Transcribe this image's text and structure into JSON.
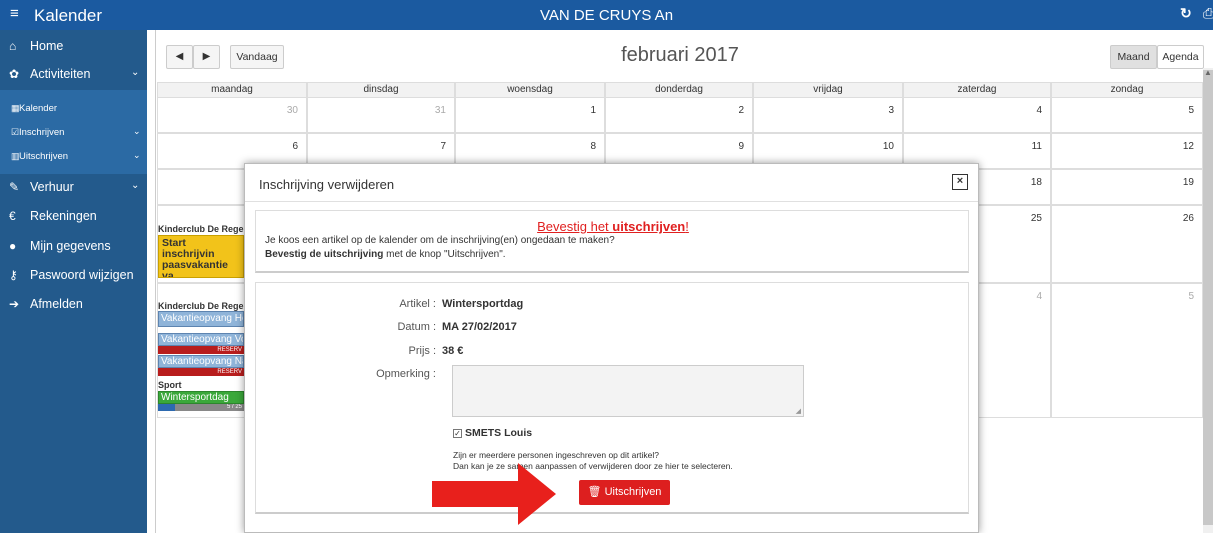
{
  "topbar": {
    "menu_icon": "hamburger-icon",
    "title": "Kalender",
    "user": "VAN DE CRUYS An",
    "refresh_icon": "refresh-icon",
    "print_icon": "print-icon"
  },
  "sidebar": {
    "items": [
      {
        "icon": "home-icon",
        "label": "Home"
      },
      {
        "icon": "activities-icon",
        "label": "Activiteiten"
      },
      {
        "icon": "rent-icon",
        "label": "Verhuur"
      },
      {
        "icon": "euro-icon",
        "label": "Rekeningen"
      },
      {
        "icon": "user-icon",
        "label": "Mijn gegevens"
      },
      {
        "icon": "key-icon",
        "label": "Paswoord wijzigen"
      },
      {
        "icon": "logout-icon",
        "label": "Afmelden"
      }
    ],
    "subitems": [
      {
        "icon": "calendar-icon",
        "label": "Kalender"
      },
      {
        "icon": "edit-icon",
        "label": "Inschrijven"
      },
      {
        "icon": "trash-icon",
        "label": "Uitschrijven"
      }
    ]
  },
  "calendar": {
    "prev": "◀",
    "next": "▶",
    "today": "Vandaag",
    "month": "februari 2017",
    "view_month": "Maand",
    "view_agenda": "Agenda",
    "weekdays": [
      "maandag",
      "dinsdag",
      "woensdag",
      "donderdag",
      "vrijdag",
      "zaterdag",
      "zondag"
    ],
    "week1": [
      "30",
      "31",
      "1",
      "2",
      "3",
      "4",
      "5"
    ],
    "week2": [
      "6",
      "7",
      "8",
      "9",
      "10",
      "11",
      "12"
    ],
    "week3_right": [
      "18",
      "19"
    ],
    "week4_right": [
      "25",
      "26"
    ],
    "week5_right": [
      "4",
      "5"
    ],
    "events": {
      "group1": "Kinderclub De Regenb",
      "promo": "Start inschrijvin paasvakantie va",
      "group2": "Kinderclub De Regenb",
      "ev1": "Vakantieopvang He",
      "ev2": "Vakantieopvang Vo",
      "ev2_badge": "RESERV",
      "ev3": "Vakantieopvang Na",
      "ev3_badge": "RESERV",
      "group3": "Sport",
      "ev4": "Wintersportdag",
      "ev4_count": "5 / 25"
    }
  },
  "modal": {
    "title": "Inschrijving verwijderen",
    "close": "×",
    "confirm_head_prefix": "Bevestig het ",
    "confirm_head_bold": "uitschrijven",
    "confirm_head_suffix": "!",
    "line1": "Je koos een artikel op de kalender om de inschrijving(en) ongedaan te maken?",
    "line2_bold": "Bevestig de uitschrijving",
    "line2_rest": " met de knop \"Uitschrijven\".",
    "artikel_label": "Artikel :",
    "artikel_value": "Wintersportdag",
    "datum_label": "Datum :",
    "datum_value": "MA 27/02/2017",
    "prijs_label": "Prijs :",
    "prijs_value": "38 €",
    "opmerking_label": "Opmerking :",
    "person": "SMETS Louis",
    "note1": "Zijn er meerdere personen ingeschreven op dit artikel?",
    "note2": "Dan kan je ze samen aanpassen of verwijderen door ze hier te selecteren.",
    "button": "Uitschrijven",
    "button_icon": "trash-icon"
  },
  "colors": {
    "topbar": "#1b5aa0",
    "sidebar": "#235a8c",
    "danger": "#dd1f1f",
    "arrow": "#e8201c"
  }
}
